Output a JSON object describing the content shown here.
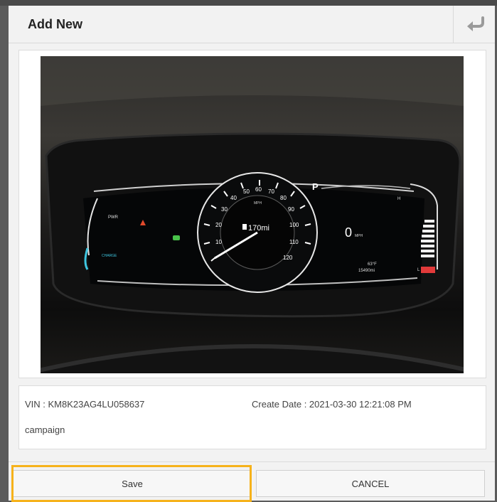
{
  "dialog": {
    "title": "Add New",
    "back_icon": "return-arrow-icon"
  },
  "photo": {
    "description_icon": "dashboard-photo",
    "dashboard": {
      "range": "170mi",
      "speed": "0",
      "speed_unit": "MPH",
      "gear": "P",
      "mph_label": "MPH",
      "temp": "63°F",
      "odometer": "15490mi",
      "pwr": "PWR",
      "charge": "CHARGE",
      "h": "H",
      "l": "L",
      "speed_ticks": [
        "10",
        "20",
        "30",
        "40",
        "50",
        "60",
        "70",
        "80",
        "90",
        "100",
        "110",
        "120"
      ]
    }
  },
  "info": {
    "vin": "VIN : KM8K23AG4LU058637",
    "create_date": "Create Date : 2021-03-30 12:21:08 PM",
    "note": "campaign"
  },
  "buttons": {
    "save": "Save",
    "cancel": "CANCEL"
  },
  "colors": {
    "highlight": "#f6b21b",
    "cluster_accent": "#3ec6e0"
  }
}
